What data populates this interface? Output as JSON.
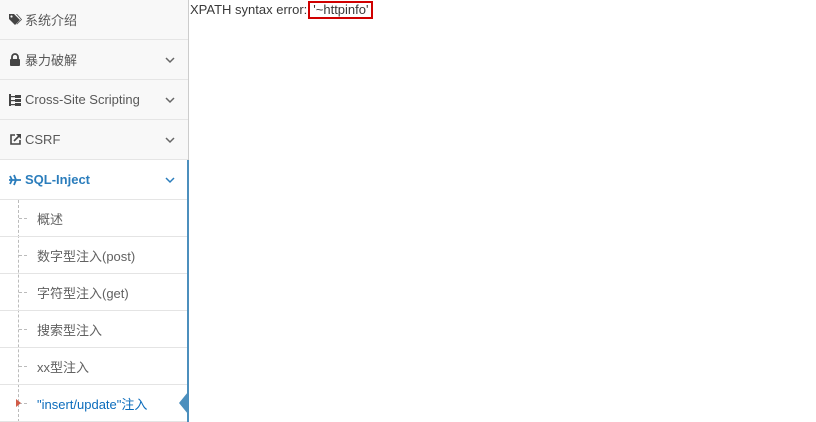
{
  "sidebar": {
    "items": [
      {
        "label": "系统介绍",
        "icon": "tags-icon"
      },
      {
        "label": "暴力破解",
        "icon": "lock-icon"
      },
      {
        "label": "Cross-Site Scripting",
        "icon": "sitemap-icon"
      },
      {
        "label": "CSRF",
        "icon": "share-icon"
      },
      {
        "label": "SQL-Inject",
        "icon": "plane-icon"
      }
    ],
    "sql_submenu": [
      {
        "label": "概述"
      },
      {
        "label": "数字型注入(post)"
      },
      {
        "label": "字符型注入(get)"
      },
      {
        "label": "搜索型注入"
      },
      {
        "label": "xx型注入"
      },
      {
        "label": "\"insert/update\"注入"
      }
    ]
  },
  "main": {
    "error_prefix": "XPATH syntax error:",
    "error_value": "'~httpinfo'"
  },
  "colors": {
    "accent": "#2b7dbc",
    "highlight_border": "#d00000",
    "active_caret": "#d15b47"
  }
}
